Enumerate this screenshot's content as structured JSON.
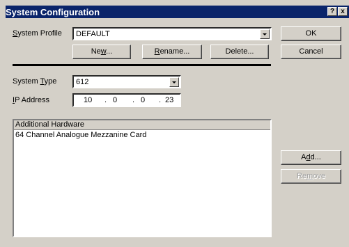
{
  "window": {
    "title": "System Configuration",
    "help_glyph": "?",
    "close_glyph": "x"
  },
  "profile": {
    "label": "System Profile",
    "value": "DEFAULT"
  },
  "buttons": {
    "new": "New...",
    "rename": "Rename...",
    "delete": "Delete...",
    "ok": "OK",
    "cancel": "Cancel",
    "add": "Add...",
    "remove": "Remove"
  },
  "system_type": {
    "label": "System Type",
    "value": "612"
  },
  "ip_address": {
    "label": "IP Address",
    "octets": [
      "10",
      "0",
      "0",
      "23"
    ]
  },
  "hardware_list": {
    "header": "Additional Hardware",
    "items": [
      "64 Channel Analogue Mezzanine Card"
    ]
  }
}
